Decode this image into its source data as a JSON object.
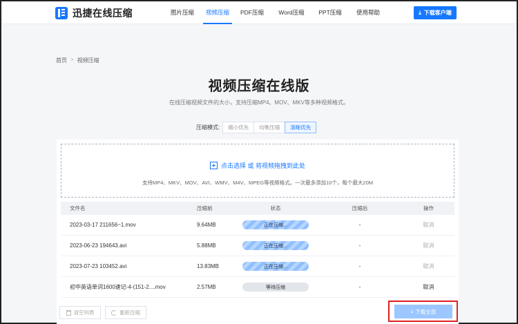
{
  "header": {
    "logo_text": "迅捷在线压缩",
    "nav": [
      "图片压缩",
      "视频压缩",
      "PDF压缩",
      "Word压缩",
      "PPT压缩",
      "使用帮助"
    ],
    "active_nav": "视频压缩",
    "download_client": "下载客户端"
  },
  "breadcrumb": {
    "home": "首页",
    "sep": ">",
    "current": "视频压缩"
  },
  "page": {
    "title": "视频压缩在线版",
    "subtitle": "在线压缩视频文件的大小，支持压缩MP4、MOV、MKV等多种视频格式。"
  },
  "mode": {
    "label": "压缩模式:",
    "options": [
      "缩小优先",
      "均衡压缩",
      "清晰优先"
    ],
    "selected": "清晰优先"
  },
  "dropzone": {
    "primary": "点击选择 或 将视频拖拽到此处",
    "hint": "支持MP4、MKV、MOV、AVI、WMV、M4V、MPEG等视频格式。一次最多添加10个，每个最大20M"
  },
  "table": {
    "headers": [
      "文件名",
      "压缩前",
      "状态",
      "压缩后",
      "操作"
    ],
    "rows": [
      {
        "name": "2023-03-17 211656~1.mov",
        "size": "9.64MB",
        "status": "正在压缩...",
        "state": "compressing",
        "after": "-",
        "action": "取消"
      },
      {
        "name": "2023-06-23 194643.avi",
        "size": "5.88MB",
        "status": "正在压缩...",
        "state": "compressing",
        "after": "-",
        "action": "取消"
      },
      {
        "name": "2023-07-23 103452.avi",
        "size": "13.83MB",
        "status": "正在压缩...",
        "state": "compressing",
        "after": "-",
        "action": "取消"
      },
      {
        "name": "初中英语单词1600速记-4-(151-2....mov",
        "size": "2.57MB",
        "status": "等待压缩",
        "state": "waiting",
        "after": "-",
        "action": "取消"
      }
    ]
  },
  "actions": {
    "clear_list": "清空列表",
    "recompress": "重新压缩",
    "download_all": "下载全部"
  },
  "colors": {
    "accent": "#1677ff",
    "highlight_frame": "#e02020"
  }
}
